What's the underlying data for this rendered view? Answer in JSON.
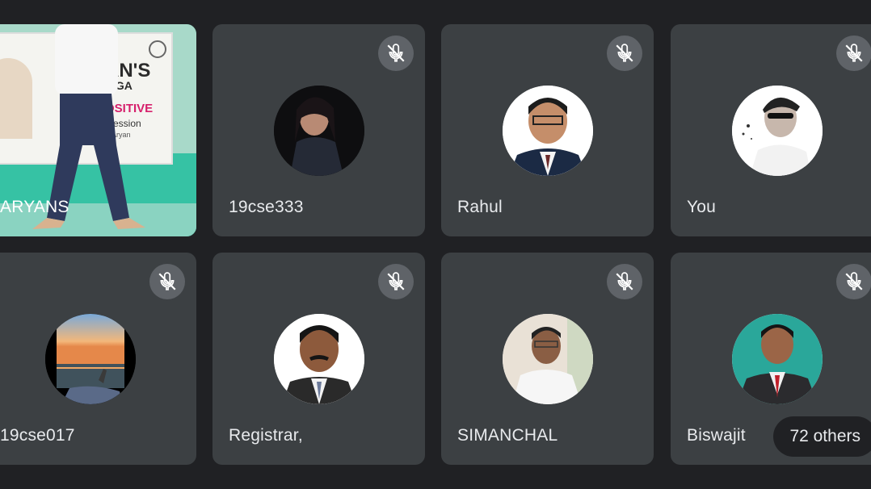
{
  "participants": [
    {
      "name": "ARYANS",
      "muted": false,
      "type": "video"
    },
    {
      "name": "19cse333",
      "muted": true,
      "avatar": "girl-photo"
    },
    {
      "name": "Rahul",
      "muted": true,
      "avatar": "man-in-suit"
    },
    {
      "name": "You",
      "muted": true,
      "avatar": "young-man-sunglasses"
    },
    {
      "name": "19cse017",
      "muted": true,
      "avatar": "sunset-sea"
    },
    {
      "name": "Registrar,",
      "muted": true,
      "avatar": "man-with-moustache"
    },
    {
      "name": "SIMANCHAL",
      "muted": true,
      "avatar": "man-white-shirt"
    },
    {
      "name": "Biswajit",
      "muted": true,
      "avatar": "man-red-tie"
    }
  ],
  "others_label": "72 others",
  "poster": {
    "line1": "AN'S",
    "line2": "OGA",
    "line3": "POSITIVE",
    "line4": "g Session",
    "line5": "hai Aryan"
  },
  "colors": {
    "background": "#202124",
    "tile": "#3c4043",
    "muted_badge": "#5f6368",
    "text": "#e8eaed"
  }
}
